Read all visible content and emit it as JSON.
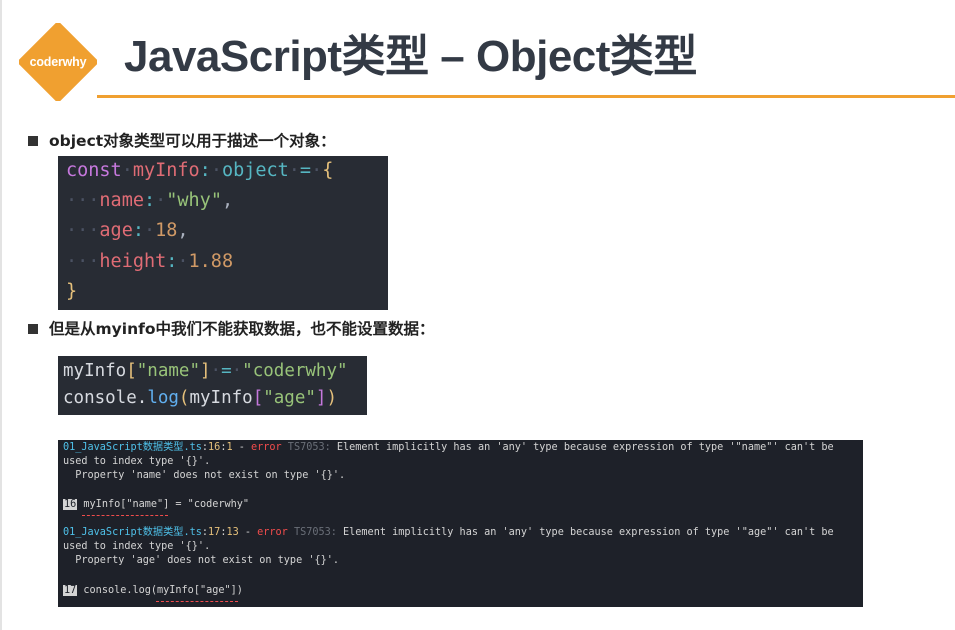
{
  "logo": {
    "text": "coderwhy",
    "color": "#f0a030"
  },
  "title": "JavaScript类型 – Object类型",
  "bullets": [
    "object对象类型可以用于描述一个对象：",
    "但是从myinfo中我们不能获取数据，也不能设置数据："
  ],
  "code1": {
    "line1": {
      "kw": "const",
      "name": "myInfo",
      "colon": ":",
      "type": "object",
      "eq": "=",
      "brace": "{"
    },
    "line2": {
      "key": "name",
      "colon": ":",
      "value": "\"why\"",
      "comma": ","
    },
    "line3": {
      "key": "age",
      "colon": ":",
      "value": "18",
      "comma": ","
    },
    "line4": {
      "key": "height",
      "colon": ":",
      "value": "1.88"
    },
    "line5": {
      "brace": "}"
    }
  },
  "code2": {
    "line1": {
      "obj": "myInfo",
      "open": "[",
      "key": "\"name\"",
      "close": "]",
      "eq": "=",
      "value": "\"coderwhy\""
    },
    "line2": {
      "obj": "console",
      "dot": ".",
      "method": "log",
      "paren_open": "(",
      "arg": "myInfo",
      "open": "[",
      "key": "\"age\"",
      "close": "]",
      "paren_close": ")"
    }
  },
  "terminal": {
    "err1": {
      "file": "01_JavaScript数据类型.ts",
      "sep": ":",
      "line": "16",
      "col": "1",
      "dash": " - ",
      "level": "error",
      "code": " TS7053:",
      "msg1": " Element implicitly has an 'any' type because expression of type '\"name\"' can't be",
      "msg2": "used to index type '{}'.",
      "msg3": "  Property 'name' does not exist on type '{}'.",
      "src_no": "16",
      "src": " myInfo[\"name\"] = \"coderwhy\""
    },
    "err2": {
      "file": "01_JavaScript数据类型.ts",
      "sep": ":",
      "line": "17",
      "col": "13",
      "dash": " - ",
      "level": "error",
      "code": " TS7053:",
      "msg1": " Element implicitly has an 'any' type because expression of type '\"age\"' can't be",
      "msg2": "used to index type '{}'.",
      "msg3": "  Property 'age' does not exist on type '{}'.",
      "src_no": "17",
      "src": " console.log(myInfo[\"age\"])"
    }
  }
}
